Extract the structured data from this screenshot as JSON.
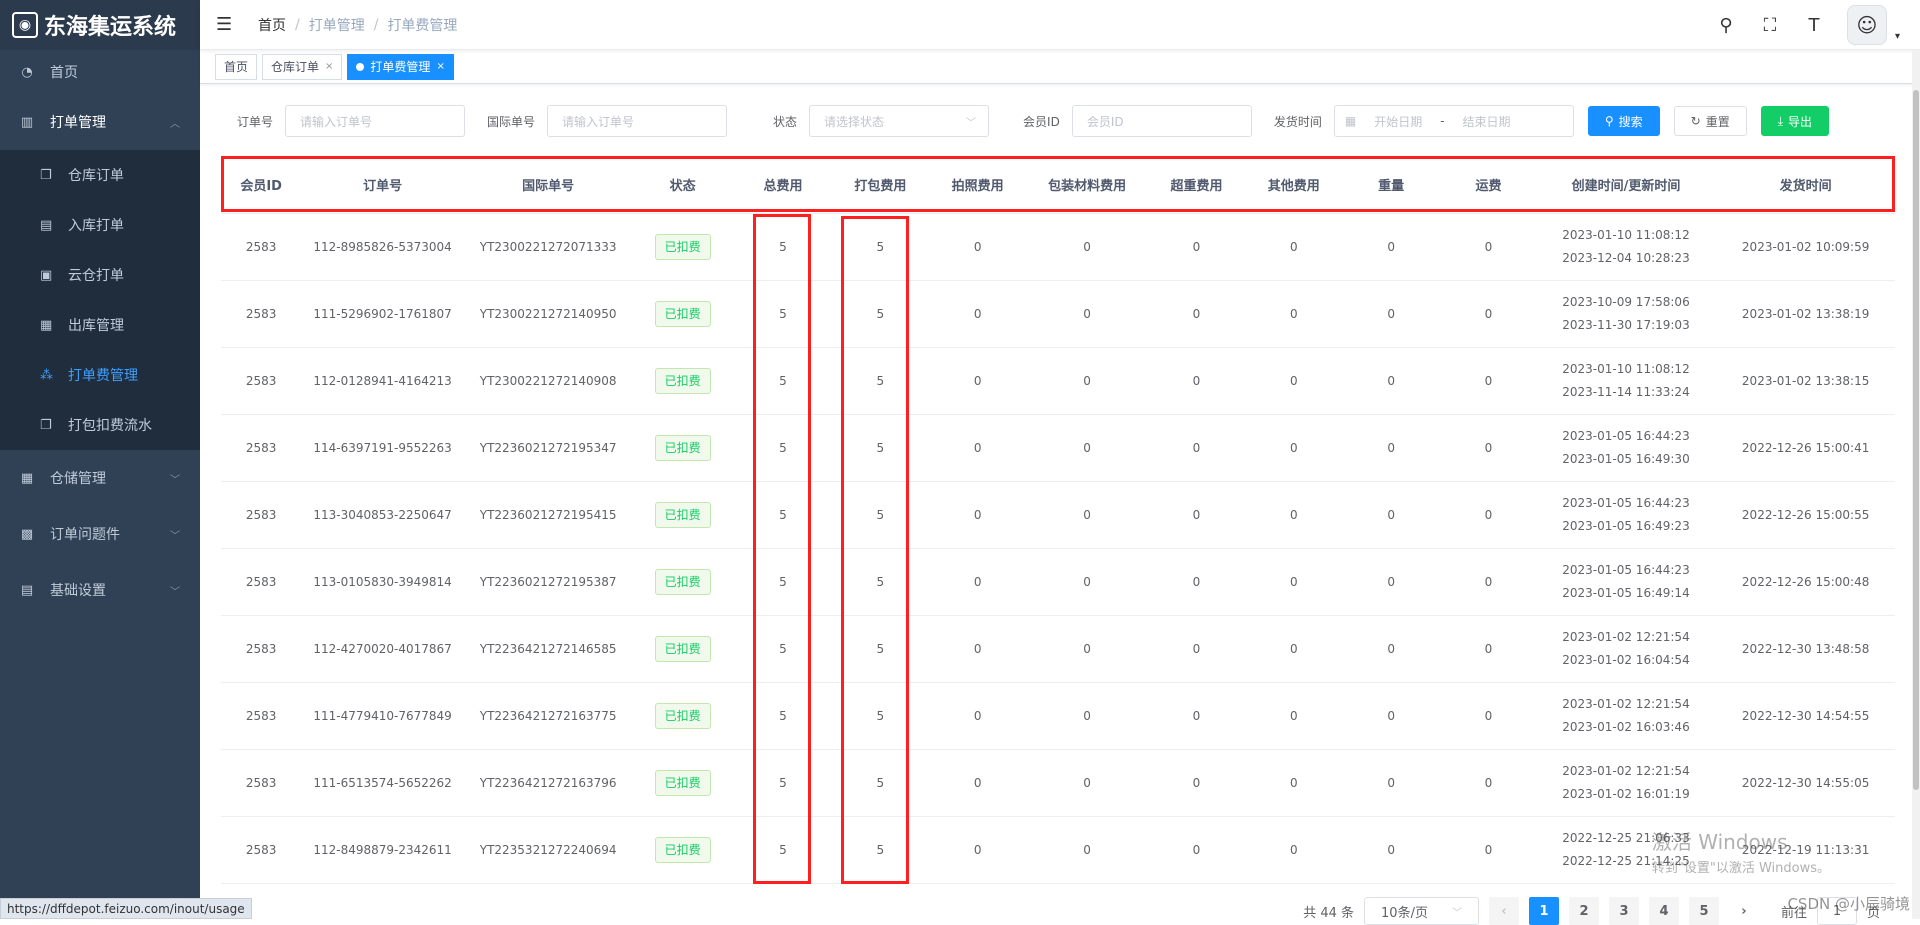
{
  "app": {
    "title": "东海集运系统"
  },
  "status_url": "https://dffdepot.feizuo.com/inout/usage",
  "sidebar": {
    "items": [
      {
        "label": "首页",
        "icon": "dashboard-icon"
      },
      {
        "label": "打单管理",
        "icon": "bar-chart-icon",
        "open": true
      },
      {
        "label": "仓储管理",
        "icon": "table-icon"
      },
      {
        "label": "订单问题件",
        "icon": "grid-icon"
      },
      {
        "label": "基础设置",
        "icon": "settings-list-icon"
      }
    ],
    "subitems": [
      {
        "label": "仓库订单",
        "icon": "copy-icon"
      },
      {
        "label": "入库打单",
        "icon": "receipt-icon"
      },
      {
        "label": "云仓打单",
        "icon": "cloud-print-icon"
      },
      {
        "label": "出库管理",
        "icon": "outbound-icon"
      },
      {
        "label": "打单费管理",
        "icon": "tree-icon",
        "active": true
      },
      {
        "label": "打包扣费流水",
        "icon": "copy-icon"
      }
    ]
  },
  "breadcrumb": [
    "首页",
    "打单管理",
    "打单费管理"
  ],
  "tags": [
    {
      "label": "首页"
    },
    {
      "label": "仓库订单",
      "closable": true
    },
    {
      "label": "打单费管理",
      "closable": true,
      "active": true
    }
  ],
  "filters": {
    "order_no": {
      "label": "订单号",
      "placeholder": "请输入订单号"
    },
    "intl_no": {
      "label": "国际单号",
      "placeholder": "请输入订单号"
    },
    "status": {
      "label": "状态",
      "placeholder": "请选择状态"
    },
    "member_id": {
      "label": "会员ID",
      "placeholder": "会员ID"
    },
    "ship_time": {
      "label": "发货时间",
      "start": "开始日期",
      "sep": "-",
      "end": "结束日期"
    },
    "search_btn": "搜索",
    "reset_btn": "重置",
    "export_btn": "导出"
  },
  "table": {
    "columns": [
      "会员ID",
      "订单号",
      "国际单号",
      "状态",
      "总费用",
      "打包费用",
      "拍照费用",
      "包装材料费用",
      "超重费用",
      "其他费用",
      "重量",
      "运费",
      "创建时间/更新时间",
      "发货时间"
    ],
    "rows": [
      [
        "2583",
        "112-8985826-5373004",
        "YT2300221272071333",
        "已扣费",
        "5",
        "5",
        "0",
        "0",
        "0",
        "0",
        "0",
        "0",
        "2023-01-10 11:08:12",
        "2023-12-04 10:28:23",
        "2023-01-02 10:09:59"
      ],
      [
        "2583",
        "111-5296902-1761807",
        "YT2300221272140950",
        "已扣费",
        "5",
        "5",
        "0",
        "0",
        "0",
        "0",
        "0",
        "0",
        "2023-10-09 17:58:06",
        "2023-11-30 17:19:03",
        "2023-01-02 13:38:19"
      ],
      [
        "2583",
        "112-0128941-4164213",
        "YT2300221272140908",
        "已扣费",
        "5",
        "5",
        "0",
        "0",
        "0",
        "0",
        "0",
        "0",
        "2023-01-10 11:08:12",
        "2023-11-14 11:33:24",
        "2023-01-02 13:38:15"
      ],
      [
        "2583",
        "114-6397191-9552263",
        "YT2236021272195347",
        "已扣费",
        "5",
        "5",
        "0",
        "0",
        "0",
        "0",
        "0",
        "0",
        "2023-01-05 16:44:23",
        "2023-01-05 16:49:30",
        "2022-12-26 15:00:41"
      ],
      [
        "2583",
        "113-3040853-2250647",
        "YT2236021272195415",
        "已扣费",
        "5",
        "5",
        "0",
        "0",
        "0",
        "0",
        "0",
        "0",
        "2023-01-05 16:44:23",
        "2023-01-05 16:49:23",
        "2022-12-26 15:00:55"
      ],
      [
        "2583",
        "113-0105830-3949814",
        "YT2236021272195387",
        "已扣费",
        "5",
        "5",
        "0",
        "0",
        "0",
        "0",
        "0",
        "0",
        "2023-01-05 16:44:23",
        "2023-01-05 16:49:14",
        "2022-12-26 15:00:48"
      ],
      [
        "2583",
        "112-4270020-4017867",
        "YT2236421272146585",
        "已扣费",
        "5",
        "5",
        "0",
        "0",
        "0",
        "0",
        "0",
        "0",
        "2023-01-02 12:21:54",
        "2023-01-02 16:04:54",
        "2022-12-30 13:48:58"
      ],
      [
        "2583",
        "111-4779410-7677849",
        "YT2236421272163775",
        "已扣费",
        "5",
        "5",
        "0",
        "0",
        "0",
        "0",
        "0",
        "0",
        "2023-01-02 12:21:54",
        "2023-01-02 16:03:46",
        "2022-12-30 14:54:55"
      ],
      [
        "2583",
        "111-6513574-5652262",
        "YT2236421272163796",
        "已扣费",
        "5",
        "5",
        "0",
        "0",
        "0",
        "0",
        "0",
        "0",
        "2023-01-02 12:21:54",
        "2023-01-02 16:01:19",
        "2022-12-30 14:55:05"
      ],
      [
        "2583",
        "112-8498879-2342611",
        "YT2235321272240694",
        "已扣费",
        "5",
        "5",
        "0",
        "0",
        "0",
        "0",
        "0",
        "0",
        "2022-12-25 21:06:33",
        "2022-12-25 21:14:25",
        "2022-12-19 11:13:31"
      ]
    ]
  },
  "pagination": {
    "total": "共 44 条",
    "page_size": "10条/页",
    "pages": [
      "1",
      "2",
      "3",
      "4",
      "5"
    ],
    "current": "1",
    "goto_label": "前往",
    "goto_value": "1",
    "goto_suffix": "页"
  },
  "watermark": {
    "line1": "激活 Windows",
    "line2": "转到\"设置\"以激活 Windows。"
  },
  "csdn": "CSDN @小辰骑境",
  "colors": {
    "sidebar_bg": "#304156",
    "primary": "#1890ff",
    "success": "#13ce66",
    "highlight": "#ff1f1f"
  }
}
